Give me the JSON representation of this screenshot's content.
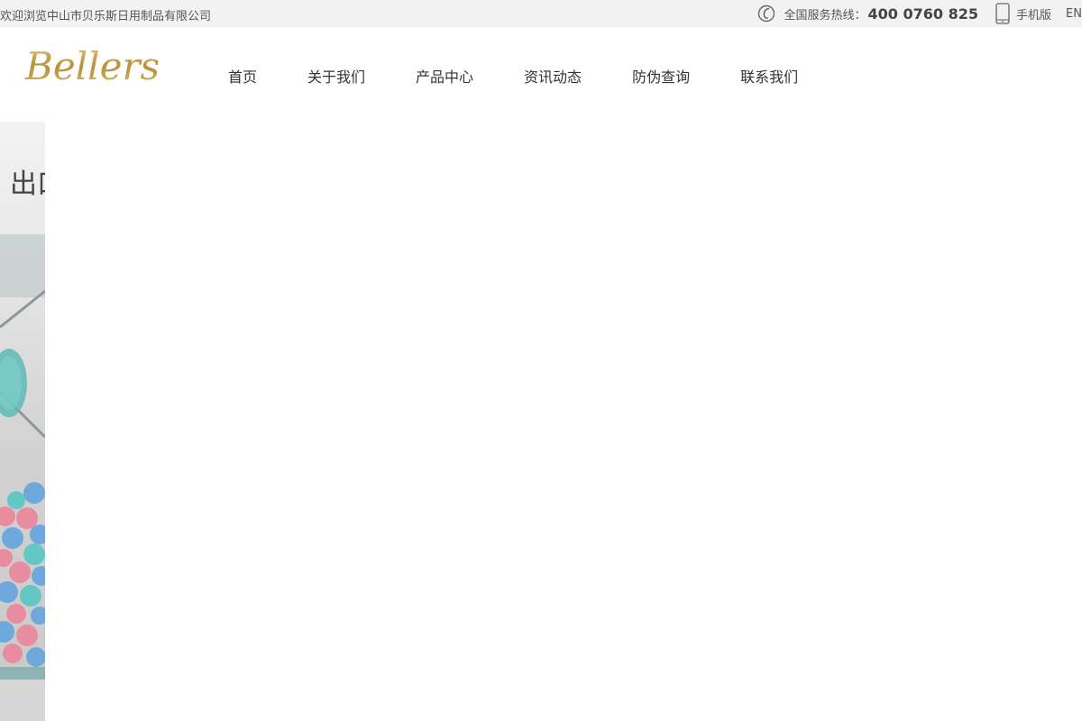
{
  "topbar": {
    "welcome": "欢迎浏览中山市贝乐斯日用制品有限公司",
    "hotline_label": "全国服务热线：",
    "hotline_number": "400 0760 825",
    "mobile_label": "手机版",
    "lang": "EN"
  },
  "logo": {
    "text": "Bellers"
  },
  "nav": {
    "items": [
      {
        "label": "首页"
      },
      {
        "label": "关于我们"
      },
      {
        "label": "产品中心"
      },
      {
        "label": "资讯动态"
      },
      {
        "label": "防伪查询"
      },
      {
        "label": "联系我们"
      }
    ]
  },
  "banner": {
    "text": "出口"
  },
  "colors": {
    "topbar_bg": "#f2f2f2",
    "logo_gold": "#c8a24e",
    "ball_blue": "#6fa8dc",
    "ball_pink": "#e88ca0",
    "ball_teal": "#63c7c5"
  }
}
